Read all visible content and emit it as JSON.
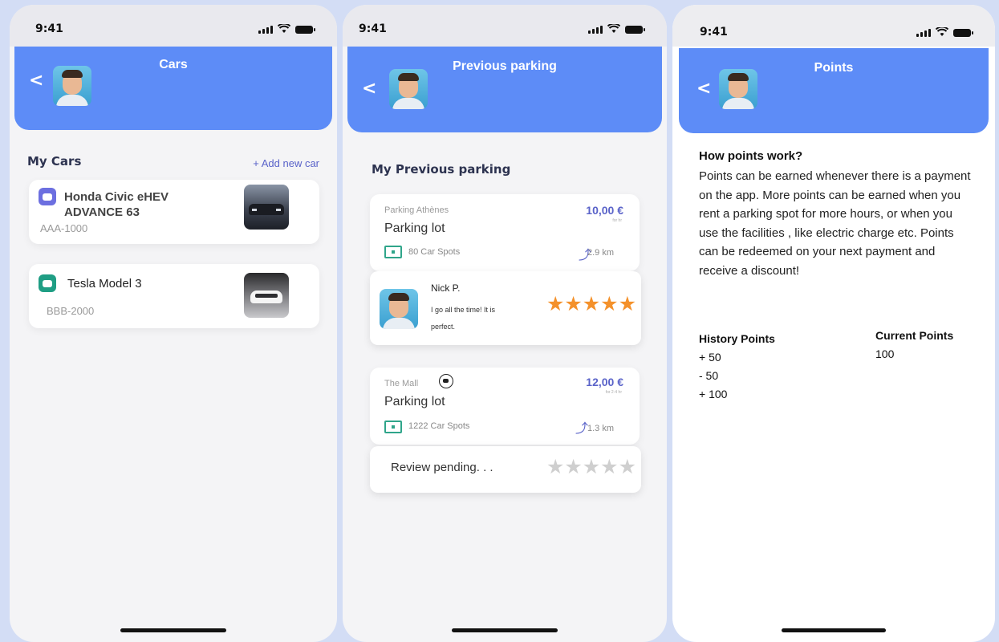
{
  "status_time": "9:41",
  "screens": {
    "cars": {
      "title": "Cars",
      "section_title": "My Cars",
      "add_link": "+ Add new car",
      "cars": [
        {
          "name_line1": "Honda Civic  eHEV",
          "name_line2": "ADVANCE 63",
          "plate": "AAA-1000",
          "icon": "car-icon",
          "icon_color": "#6c6fe0"
        },
        {
          "name_line1": "Tesla Model 3",
          "name_line2": "",
          "plate": "BBB-2000",
          "icon": "electric-car-icon",
          "icon_color": "#1f9e84"
        }
      ]
    },
    "previous_parking": {
      "title": "Previous parking",
      "section_title": "My Previous parking",
      "parkings": [
        {
          "place": "Parking Athènes",
          "type": "Parking lot",
          "price": "10,00 €",
          "unit": "for hr",
          "spots": "80 Car Spots",
          "distance": "2.9 km"
        },
        {
          "place": "The Mall",
          "type": "Parking lot",
          "price": "12,00 €",
          "unit": "for 2-4 hr",
          "spots": "1222 Car Spots",
          "distance": "1.3 km"
        }
      ],
      "review": {
        "name": "Nick P.",
        "text": "I go all the time! It is perfect.",
        "stars": "★★★★★",
        "rating": 5
      },
      "pending": {
        "text": "Review pending. . .",
        "stars": "★★★★★",
        "rating": 0
      }
    },
    "points": {
      "title": "Points",
      "heading": "How points work?",
      "body": "Points can be earned whenever there is a payment on the app. More points can be earned when you rent a parking spot for more hours, or when you use the facilities , like electric charge etc. Points can be redeemed on your next payment and receive a discount!",
      "history_label": "History Points",
      "history": [
        "+ 50",
        "- 50",
        "+ 100"
      ],
      "current_label": "Current Points",
      "current_value": "100"
    }
  },
  "colors": {
    "header": "#5d8cf7",
    "accent": "#5a63c9",
    "star": "#f4912b",
    "spot": "#2fa58a"
  }
}
